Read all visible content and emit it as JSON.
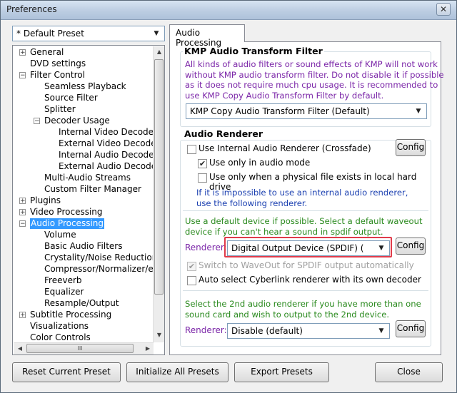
{
  "window": {
    "title": "Preferences",
    "close_glyph": "✕"
  },
  "preset": {
    "selected": "* Default Preset"
  },
  "tree": {
    "items": [
      {
        "label": "General",
        "expander": "+"
      },
      {
        "label": "DVD settings",
        "expander": ""
      },
      {
        "label": "Filter Control",
        "expander": "−"
      },
      {
        "label": "Seamless Playback",
        "expander": ""
      },
      {
        "label": "Source Filter",
        "expander": ""
      },
      {
        "label": "Splitter",
        "expander": ""
      },
      {
        "label": "Decoder Usage",
        "expander": "−"
      },
      {
        "label": "Internal Video Decoder",
        "expander": ""
      },
      {
        "label": "External Video Decoder",
        "expander": ""
      },
      {
        "label": "Internal Audio Decoder",
        "expander": ""
      },
      {
        "label": "External Audio Decoder",
        "expander": ""
      },
      {
        "label": "Multi-Audio Streams",
        "expander": ""
      },
      {
        "label": "Custom Filter Manager",
        "expander": ""
      },
      {
        "label": "Plugins",
        "expander": "+"
      },
      {
        "label": "Video Processing",
        "expander": "+"
      },
      {
        "label": "Audio Processing",
        "expander": "−"
      },
      {
        "label": "Volume",
        "expander": ""
      },
      {
        "label": "Basic Audio Filters",
        "expander": ""
      },
      {
        "label": "Crystality/Noise Reduction",
        "expander": ""
      },
      {
        "label": "Compressor/Normalizer/etc",
        "expander": ""
      },
      {
        "label": "Freeverb",
        "expander": ""
      },
      {
        "label": "Equalizer",
        "expander": ""
      },
      {
        "label": "Resample/Output",
        "expander": ""
      },
      {
        "label": "Subtitle Processing",
        "expander": "+"
      },
      {
        "label": "Visualizations",
        "expander": ""
      },
      {
        "label": "Color Controls",
        "expander": ""
      }
    ],
    "selected_label": "Audio Processing",
    "hscroll_grip": "III"
  },
  "tab": {
    "label": "Audio Processing"
  },
  "kmp_group": {
    "title": "KMP Audio Transform Filter",
    "description_lines": [
      "All kinds of audio filters or sound effects of KMP will not work",
      "without KMP audio transform filter. Do not disable it if possible",
      "as it does not require much cpu usage. It is recommended to",
      "use KMP Copy Audio Transform Filter by default."
    ],
    "filter_selected": "KMP Copy Audio Transform Filter (Default)"
  },
  "renderer_group": {
    "title": "Audio Renderer",
    "use_internal_label": "Use Internal Audio Renderer (Crossfade)",
    "use_internal_checked": false,
    "config_label": "Config",
    "only_audio_mode_label": "Use only in audio mode",
    "only_audio_mode_checked": true,
    "only_physical_label": "Use only when a physical file exists in local hard drive",
    "only_physical_checked": false,
    "impossible_lines": [
      "If it is impossible to use an internal audio renderer,",
      "use the following renderer."
    ],
    "default_device_lines": [
      "Use a default device if possible. Select a default waveout",
      "device if you can't hear a sound in spdif output."
    ],
    "renderer_label": "Renderer:",
    "renderer_selected": "Digital Output Device (SPDIF) (",
    "switch_waveout_label": "Switch to WaveOut for SPDIF output automatically",
    "switch_waveout_checked": true,
    "auto_select_label": "Auto select Cyberlink renderer with its own decoder",
    "auto_select_checked": false,
    "second_lines": [
      "Select the 2nd audio renderer if you have more than one",
      "sound card and wish to output to the 2nd device."
    ],
    "renderer2_label": "Renderer:",
    "renderer2_selected": "Disable (default)"
  },
  "footer": {
    "reset_label": "Reset Current Preset",
    "initialize_label": "Initialize All Presets",
    "export_label": "Export Presets",
    "close_label": "Close"
  },
  "colors": {
    "highlight_box": "#e03b4a",
    "purple_text": "#7b26a8",
    "blue_text": "#1a3fb0",
    "green_text": "#2a8a1e",
    "selection": "#3399ff"
  }
}
